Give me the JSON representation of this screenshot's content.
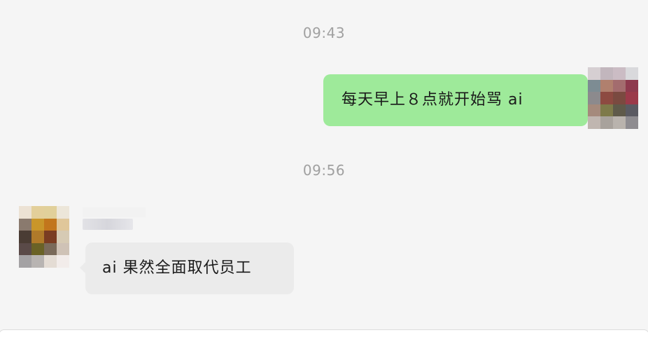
{
  "messages": [
    {
      "timestamp": "09:43",
      "direction": "outgoing",
      "text": "每天早上８点就开始骂 ai"
    },
    {
      "timestamp": "09:56",
      "direction": "incoming",
      "text": "ai 果然全面取代员工"
    }
  ],
  "colors": {
    "background": "#f5f5f5",
    "outgoing_bubble": "#9eea9a",
    "incoming_bubble": "#ebebeb",
    "timestamp_text": "#a0a0a0"
  },
  "avatars": {
    "me": {
      "icon": "pixelated-avatar-icon",
      "pixels": [
        "#d6cfd2",
        "#c2b6bd",
        "#cbbcc4",
        "#d9d9dc",
        "#7d8c93",
        "#b0806e",
        "#a36c6e",
        "#8e3a4e",
        "#8c8a8d",
        "#8d4a41",
        "#7a4a40",
        "#9b3a4a",
        "#a58a7c",
        "#7e7a4a",
        "#5f5a4a",
        "#5a5a62",
        "#c0b6b0",
        "#a8a29c",
        "#b9b3ad",
        "#8e8c90"
      ]
    },
    "them": {
      "icon": "pixelated-avatar-icon",
      "pixels": [
        "#ece2d4",
        "#e3cf9a",
        "#e1d09a",
        "#ece6d9",
        "#8a7a6e",
        "#c9962a",
        "#c2761c",
        "#e0c79a",
        "#4a3c34",
        "#b07a2a",
        "#7a3c22",
        "#d6cab4",
        "#5a4a48",
        "#6a6226",
        "#7a6a5a",
        "#cfc2b6",
        "#a4a2a4",
        "#b8b4b2",
        "#e4dcd4",
        "#f2ecea"
      ]
    }
  }
}
